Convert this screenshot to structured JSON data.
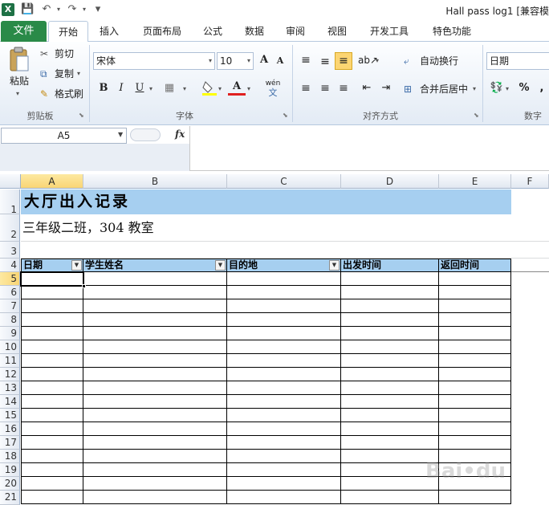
{
  "window": {
    "app_icon_label": "X",
    "title": "Hall pass log1  [兼容模"
  },
  "quick_access": {
    "save_glyph": "💾",
    "undo_glyph": "↶",
    "redo_glyph": "↷",
    "customize_glyph": "▾"
  },
  "ribbon_tabs": {
    "file": "文件",
    "items": [
      "开始",
      "插入",
      "页面布局",
      "公式",
      "数据",
      "审阅",
      "视图",
      "开发工具",
      "特色功能"
    ]
  },
  "clipboard": {
    "paste": "粘贴",
    "cut": "剪切",
    "copy": "复制",
    "format_painter": "格式刷",
    "group_label": "剪贴板"
  },
  "font": {
    "name": "宋体",
    "size": "10",
    "bold": "B",
    "italic": "I",
    "underline": "U",
    "grow": "A",
    "shrink": "A",
    "font_color": "A",
    "phonetic": "wén",
    "group_label": "字体"
  },
  "alignment": {
    "wrap_text": "自动换行",
    "merge_center": "合并后居中",
    "group_label": "对齐方式"
  },
  "number": {
    "format": "日期",
    "percent": "%",
    "comma": ",",
    "group_label": "数字"
  },
  "formula_bar": {
    "name_box": "A5",
    "fx": "fx"
  },
  "sheet": {
    "columns": [
      "A",
      "B",
      "C",
      "D",
      "E",
      "F"
    ],
    "rows": [
      "1",
      "2",
      "3",
      "4",
      "5",
      "6",
      "7",
      "8",
      "9",
      "10",
      "11",
      "12",
      "13",
      "14",
      "15",
      "16",
      "17",
      "18",
      "19",
      "20",
      "21"
    ],
    "title": "大厅出入记录",
    "subtitle": "三年级二班，304 教室",
    "headers": [
      "日期",
      "学生姓名",
      "目的地",
      "出发时间",
      "返回时间"
    ],
    "selected_cell": "A5",
    "header_fill": "#a6cff0"
  }
}
